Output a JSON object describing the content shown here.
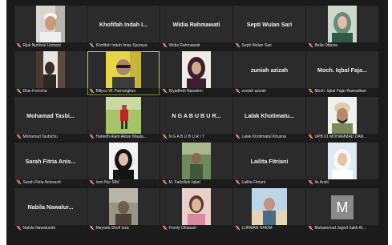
{
  "participants": [
    {
      "label": "Rijal Nurfarul Usmani",
      "name": "",
      "video": "man-white-cap"
    },
    {
      "label": "Khofifah Indah Imas Syuroya",
      "name": "Khofifah Indah I...",
      "video": ""
    },
    {
      "label": "Widia Rahmawati",
      "name": "Widia Rahmawati",
      "video": ""
    },
    {
      "label": "Septi Wulan Sari",
      "name": "Septi Wulan Sari",
      "video": ""
    },
    {
      "label": "Bella Ottavia",
      "name": "",
      "video": "woman-hijab-light"
    },
    {
      "label": "Dian Ferricha",
      "name": "",
      "video": "person-dark-room"
    },
    {
      "label": "Billyco W. Pamungkas",
      "name": "",
      "video": "man-yellow-sunglasses"
    },
    {
      "label": "Riyadhoh Nasution",
      "name": "",
      "video": "woman-hijab-dark"
    },
    {
      "label": "zuniah azizah",
      "name": "zuniah azizah",
      "video": ""
    },
    {
      "label": "Moch. Iqbal Fajar Ramadhan",
      "name": "Moch. Iqbal Faja...",
      "video": ""
    },
    {
      "label": "Mohamad Tasbichu",
      "name": "Mohamad Tasbi...",
      "video": ""
    },
    {
      "label": "Hariedh Alam Akbar Maula...",
      "name": "",
      "video": "person-outdoor"
    },
    {
      "label": "N G A B U B U R I T",
      "name": "N G A B U B U R...",
      "video": ""
    },
    {
      "label": "Lalak Khotimatul Khusna",
      "name": "Lalak Khotimatu...",
      "video": ""
    },
    {
      "label": "UPB 01 MOHAMMAD DAN...",
      "name": "",
      "video": "man-turban"
    },
    {
      "label": "Sarah Fitria Anissanti",
      "name": "Sarah Fitria Anis...",
      "video": ""
    },
    {
      "label": "Izmi Nur Sifa'",
      "name": "",
      "video": "woman-hijab-black"
    },
    {
      "label": "M. Fadzillah Iqbal",
      "name": "",
      "video": "person-green"
    },
    {
      "label": "Lailita Fitriani",
      "name": "Lailita Fitriani",
      "video": ""
    },
    {
      "label": "Iis Arsiti",
      "name": "",
      "video": "woman-hijab-white"
    },
    {
      "label": "Nabila Nawalurobi",
      "name": "Nabila Nawalur...",
      "video": ""
    },
    {
      "label": "Mayada Shofi Izza",
      "name": "",
      "video": "person-dim"
    },
    {
      "label": "Frenty Oktasari",
      "name": "",
      "video": "woman-pink"
    },
    {
      "label": "LUKMAN HAKIM",
      "name": "",
      "video": "man-beach"
    },
    {
      "label": "Muhammad Jaged Sakti Al...",
      "name": "",
      "video": "avatar-letter",
      "initial": "M"
    }
  ],
  "active_index": 6,
  "icons": {
    "mic": "mic-muted-icon"
  },
  "colors": {
    "active_border": "#c3d64a",
    "mic_muted": "#e0443c",
    "tile_bg": "#2b2b2b"
  }
}
